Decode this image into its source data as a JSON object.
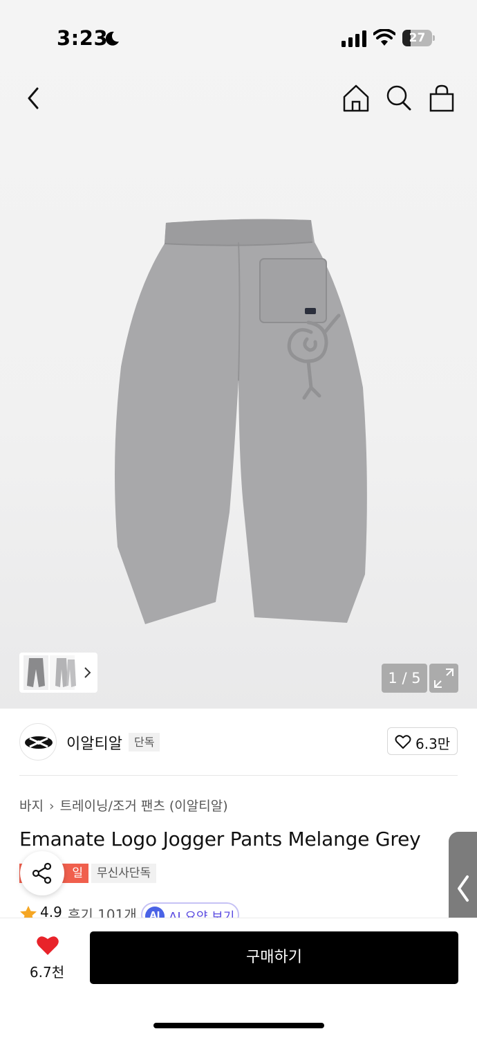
{
  "status_bar": {
    "time": "3:23",
    "battery_level": "27",
    "battery_fraction": 0.27,
    "icons": [
      "moon-icon",
      "signal-icon",
      "wifi-icon",
      "battery-icon"
    ]
  },
  "nav": {
    "icons": [
      "back-icon",
      "home-icon",
      "search-icon",
      "cart-icon"
    ]
  },
  "gallery": {
    "current_page": "1",
    "total_pages": "5",
    "counter_text": "1 / 5",
    "image_subject": "grey jogger pants back view"
  },
  "brand": {
    "name": "이알티알",
    "exclusive_label": "단독",
    "like_count": "6.3만"
  },
  "breadcrumb": {
    "category": "바지",
    "subcategory": "트레이닝/조거 팬츠 (이알티알)"
  },
  "product": {
    "title": "Emanate Logo Jogger Pants Melange Grey",
    "sale_badge": "세일",
    "sale_badge_visible": "일",
    "musinsa_badge": "무신사단독",
    "rating": "4.9",
    "review_count": "후기 101개",
    "ai_chip": "AI",
    "ai_summary_label": "AI 요약 보기"
  },
  "bottom_bar": {
    "wish_count": "6.7천",
    "buy_label": "구매하기"
  },
  "colors": {
    "accent_red": "#e8232a",
    "sale_orange": "#f05f4d",
    "ai_blue": "#4a63e6",
    "ai_purple": "#5a4be0",
    "buy_button": "#000000",
    "pants_grey": "#a7a7a9"
  }
}
